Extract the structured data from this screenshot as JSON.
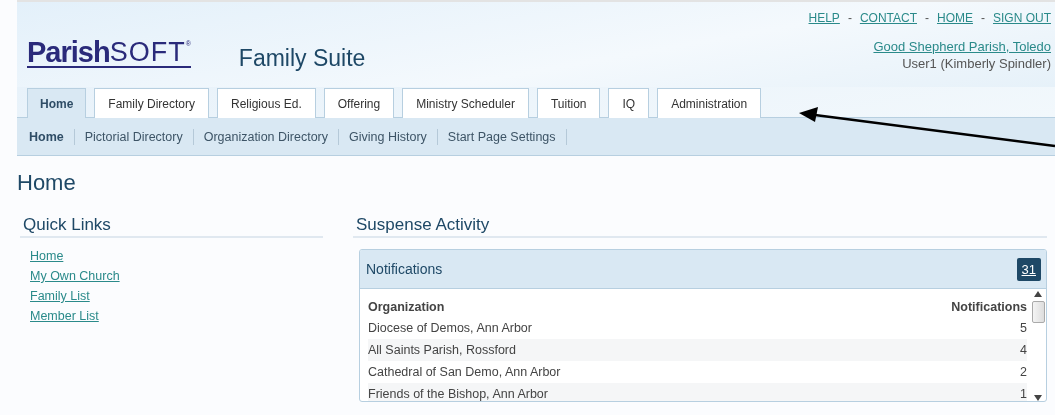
{
  "logo": {
    "bold": "Parish",
    "light": "SOFT",
    "mark": "®"
  },
  "app_title": "Family Suite",
  "top_links": [
    {
      "label": "HELP"
    },
    {
      "label": "CONTACT"
    },
    {
      "label": "HOME"
    },
    {
      "label": "SIGN OUT"
    }
  ],
  "top_link_separator": "-",
  "parish_link": "Good Shepherd Parish, Toledo",
  "user": "User1 (Kimberly Spindler)",
  "tabs": [
    {
      "label": "Home",
      "selected": true
    },
    {
      "label": "Family Directory",
      "selected": false
    },
    {
      "label": "Religious Ed.",
      "selected": false
    },
    {
      "label": "Offering",
      "selected": false
    },
    {
      "label": "Ministry Scheduler",
      "selected": false
    },
    {
      "label": "Tuition",
      "selected": false
    },
    {
      "label": "IQ",
      "selected": false
    },
    {
      "label": "Administration",
      "selected": false
    }
  ],
  "subnav": [
    {
      "label": "Home",
      "selected": true
    },
    {
      "label": "Pictorial Directory",
      "selected": false
    },
    {
      "label": "Organization Directory",
      "selected": false
    },
    {
      "label": "Giving History",
      "selected": false
    },
    {
      "label": "Start Page Settings",
      "selected": false
    }
  ],
  "page_title": "Home",
  "quick_links": {
    "title": "Quick Links",
    "items": [
      "Home",
      "My Own Church",
      "Family List",
      "Member List"
    ]
  },
  "suspense": {
    "title": "Suspense Activity",
    "panel_title": "Notifications",
    "count": "31",
    "columns": [
      "Organization",
      "Notifications"
    ],
    "rows": [
      [
        "Diocese of Demos, Ann Arbor",
        "5"
      ],
      [
        "All Saints Parish, Rossford",
        "4"
      ],
      [
        "Cathedral of San Demo, Ann Arbor",
        "2"
      ],
      [
        "Friends of the Bishop, Ann Arbor",
        "1"
      ]
    ]
  }
}
